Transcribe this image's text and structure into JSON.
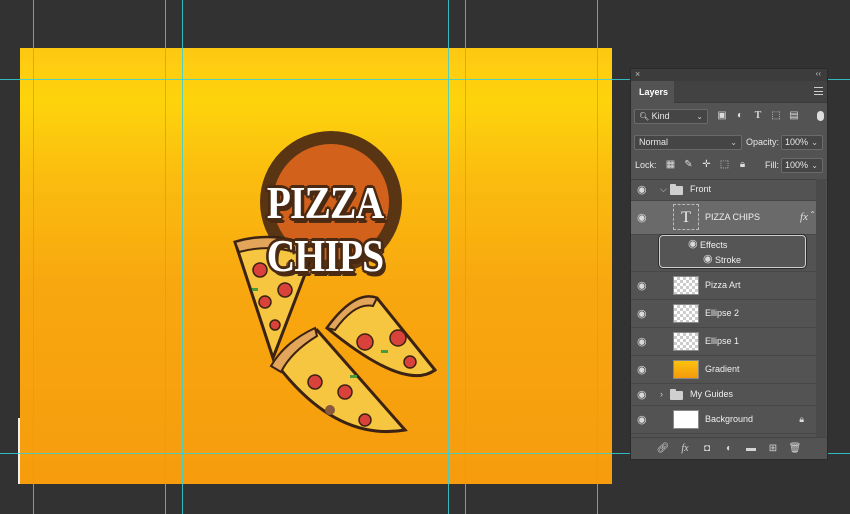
{
  "canvas": {
    "logo_text": "PIZZA CHIPS"
  },
  "panel": {
    "close": "×",
    "collapse": "‹‹",
    "tab": "Layers",
    "filter_kind": "Kind",
    "blend_mode": "Normal",
    "opacity_label": "Opacity:",
    "opacity_value": "100%",
    "lock_label": "Lock:",
    "fill_label": "Fill:",
    "fill_value": "100%"
  },
  "layers": {
    "front": "Front",
    "pizza_chips": "PIZZA CHIPS",
    "fx": "fx",
    "effects": "Effects",
    "stroke": "Stroke",
    "pizza_art": "Pizza Art",
    "ellipse2": "Ellipse 2",
    "ellipse1": "Ellipse 1",
    "gradient": "Gradient",
    "my_guides": "My Guides",
    "background": "Background"
  },
  "colors": {
    "canvas_top": "#fec812",
    "canvas_bottom": "#f69c0d",
    "guide": "#35d0d8",
    "circle_outer": "#5a3514",
    "circle_inner": "#d2611c"
  }
}
